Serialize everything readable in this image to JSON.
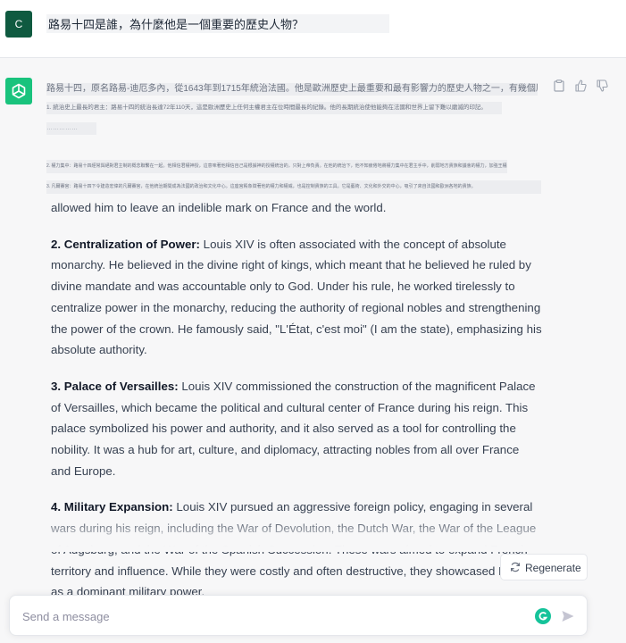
{
  "user": {
    "avatar_letter": "C",
    "question": "路易十四是誰，為什麼他是一個重要的歷史人物？"
  },
  "assistant": {
    "blurred_lines": [
      "路易十四，原名路易-迪厄多內，從1643年到1715年統治法國。他是歐洲歷史上最重要和最有影響力的歷史人物之一，有幾個原因：",
      "1. 統治史上最長的君主：路易十四的統治長達72年110天，這是歐洲歷史上任何主權君主在位時間最長的紀錄。他的長期統治使他能夠在法國和世界上留下難以磨滅的印記。",
      "……………",
      "2. 權力集中：路易十四經常與絕對君主制的概念聯繫在一起。他相信君權神授，這意味著他相信自己是根據神的授權統治的，只對上帝負責。在他的統治下，他不知疲倦地將權力集中在君主手中，削弱地方貴族和議會的權力，加強王權。他有句名言：「朕即國家」，強調他的絕對權威。",
      "3. 凡爾賽宮：路易十四下令建造宏偉的凡爾賽宮，在他統治期間成為法國的政治和文化中心。這座宮殿象徵著他的權力和權威，也是控制貴族的工具。它是藝術、文化和外交的中心，吸引了來自法國和歐洲各地的貴族。"
    ],
    "continuation": "allowed him to leave an indelible mark on France and the world.",
    "points": [
      {
        "heading": "2. Centralization of Power:",
        "text": " Louis XIV is often associated with the concept of absolute monarchy. He believed in the divine right of kings, which meant that he believed he ruled by divine mandate and was accountable only to God. Under his rule, he worked tirelessly to centralize power in the monarchy, reducing the authority of regional nobles and strengthening the power of the crown. He famously said, \"L'État, c'est moi\" (I am the state), emphasizing his absolute authority."
      },
      {
        "heading": "3. Palace of Versailles:",
        "text": " Louis XIV commissioned the construction of the magnificent Palace of Versailles, which became the political and cultural center of France during his reign. This palace symbolized his power and authority, and it also served as a tool for controlling the nobility. It was a hub for art, culture, and diplomacy, attracting nobles from all over France and Europe."
      },
      {
        "heading": "4. Military Expansion:",
        "text": " Louis XIV pursued an aggressive foreign policy, engaging in several wars during his reign, including the War of Devolution, the Dutch War, the War of the League of Augsburg, and the War of the Spanish Succession. These wars aimed to expand French territory and influence. While they were costly and often destructive, they showcased France as a dominant military power."
      }
    ]
  },
  "controls": {
    "regenerate_label": "Regenerate",
    "input_placeholder": "Send a message"
  },
  "icons": {
    "copy": "clipboard-icon",
    "like": "thumbs-up-icon",
    "dislike": "thumbs-down-icon",
    "regenerate": "refresh-icon",
    "send": "send-icon",
    "extension": "grammarly-icon"
  },
  "colors": {
    "user_avatar": "#0f5a40",
    "assistant_avatar": "#19c37d",
    "assistant_background": "#f7f7f8"
  }
}
